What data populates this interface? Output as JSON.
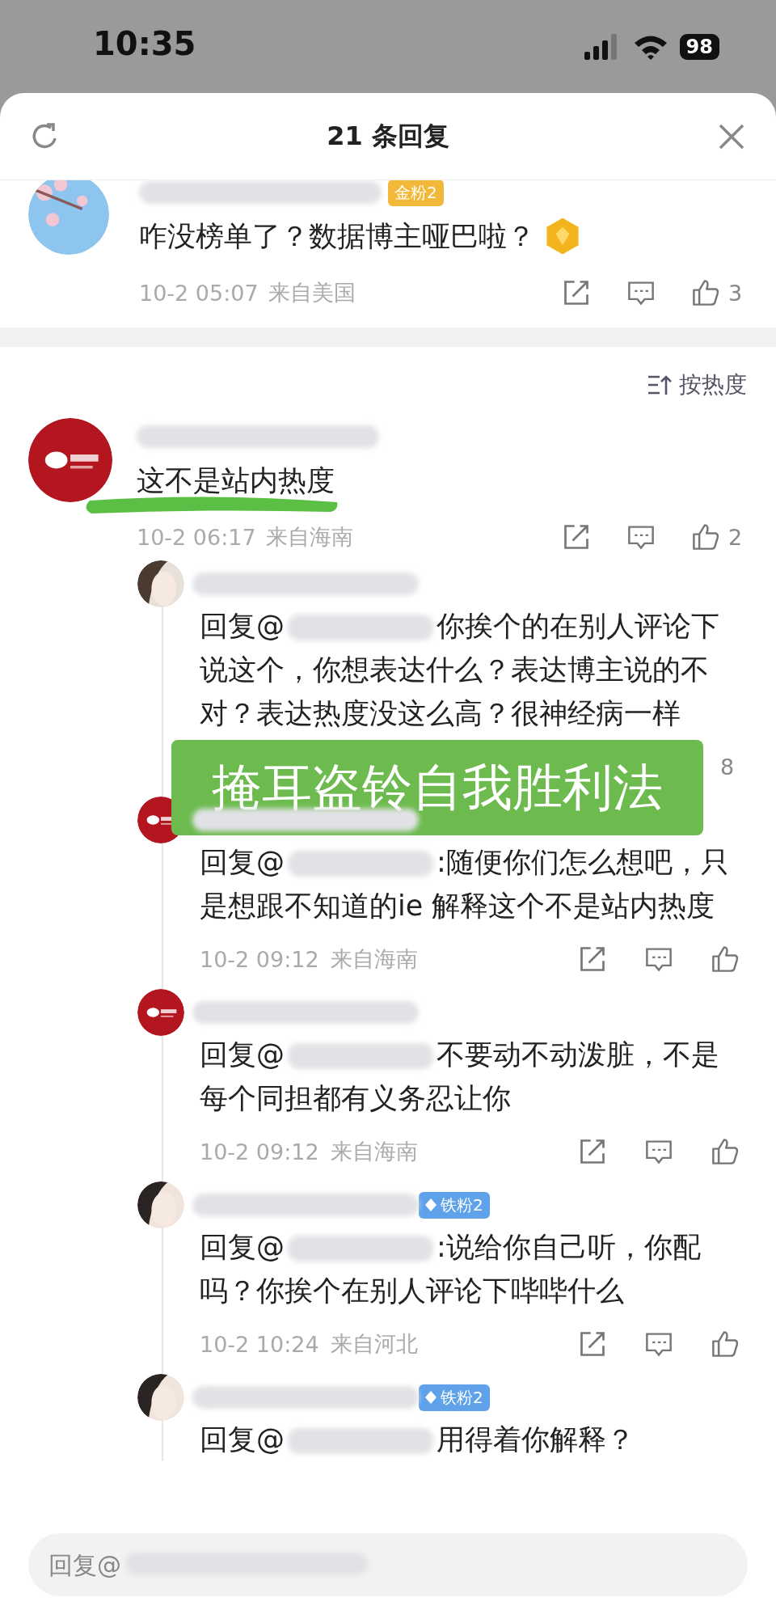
{
  "status_bar": {
    "time": "10:35",
    "battery": "98"
  },
  "sheet": {
    "title": "21 条回复"
  },
  "top_comment": {
    "badge": "金粉2",
    "text": "咋没榜单了？数据博主哑巴啦？",
    "time": "10-2 05:07",
    "location": "来自美国",
    "likes": "3"
  },
  "sort": {
    "label": "按热度"
  },
  "comment": {
    "text": "这不是站内热度",
    "highlighted": true,
    "time": "10-2 06:17",
    "location": "来自海南",
    "likes": "2"
  },
  "replies": [
    {
      "prefix": "回复@",
      "text": "你挨个的在别人评论下说这个，你想表达什么？表达博主说的不对？表达热度没这么高？很神经病一样",
      "likes": "8",
      "overlay": "掩耳盗铃自我胜利法"
    },
    {
      "prefix": "回复@",
      "text": ":随便你们怎么想吧，只是想跟不知道的ie 解释这个不是站内热度",
      "time": "10-2 09:12",
      "location": "来自海南"
    },
    {
      "prefix": "回复@",
      "text": "不要动不动泼脏，不是每个同担都有义务忍让你",
      "time": "10-2 09:12",
      "location": "来自海南"
    },
    {
      "badge": "铁粉2",
      "prefix": "回复@",
      "text": ":说给你自己听，你配吗？你挨个在别人评论下哔哔什么",
      "time": "10-2 10:24",
      "location": "来自河北"
    },
    {
      "badge": "铁粉2",
      "prefix": "回复@",
      "text": "用得着你解释？"
    }
  ],
  "reply_field": {
    "placeholder": "回复@"
  }
}
